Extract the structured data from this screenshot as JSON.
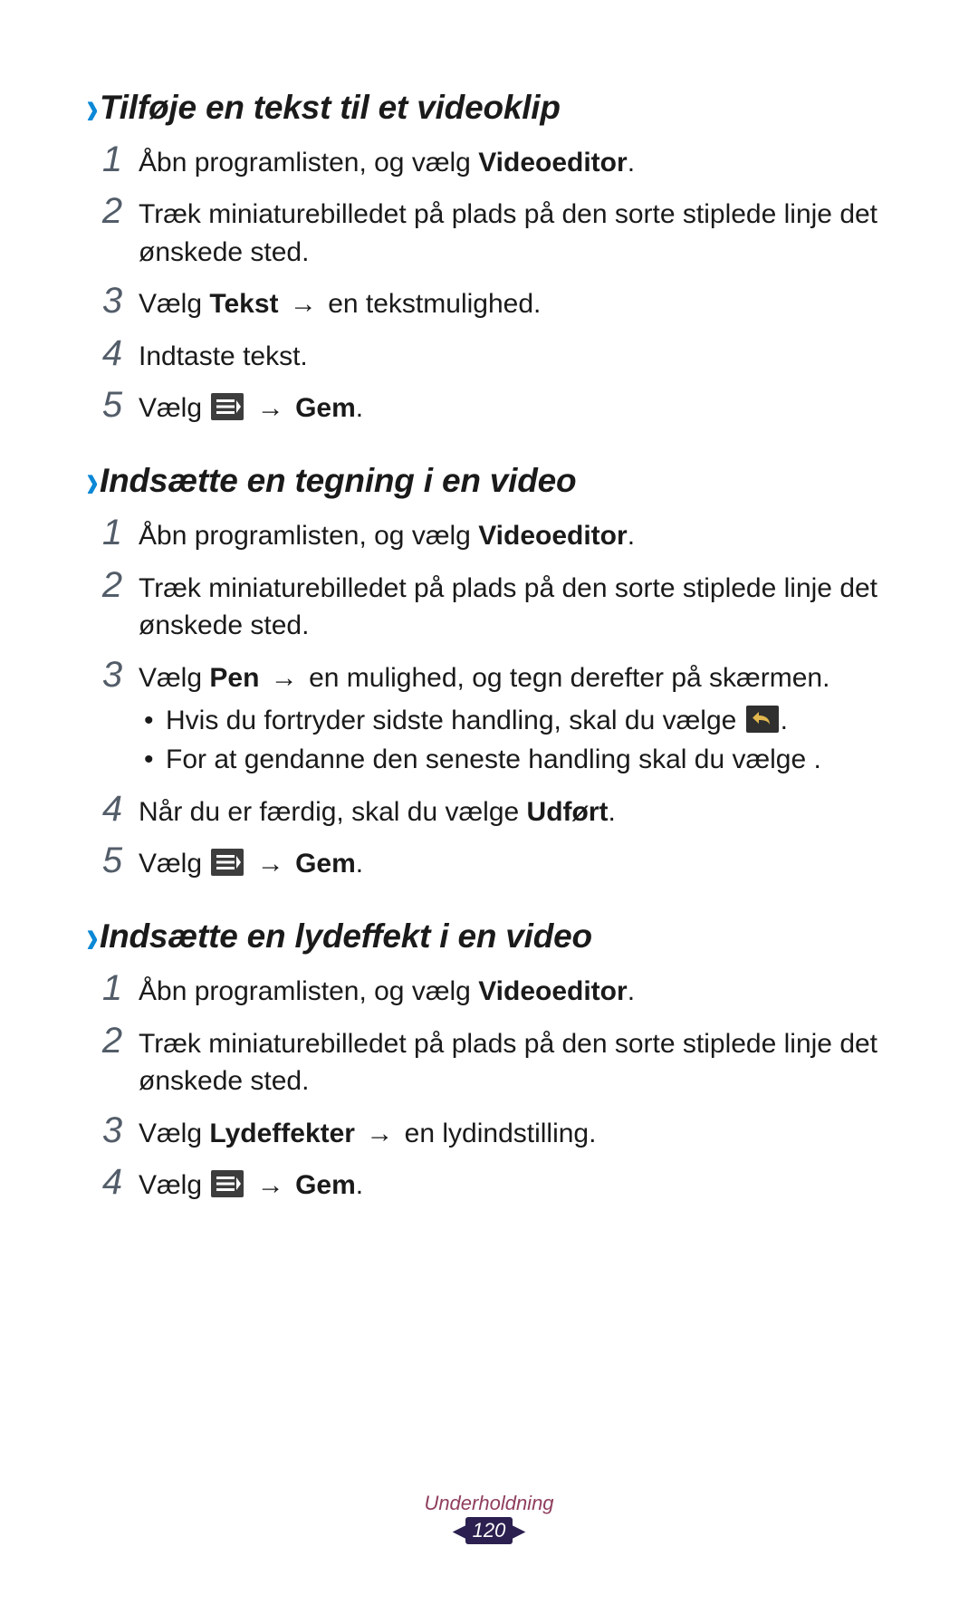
{
  "sections": [
    {
      "title": "Tilføje en tekst til et videoklip",
      "steps": [
        {
          "num": "1",
          "html": "Åbn programlisten, og vælg <span class='bold'>Videoeditor</span>."
        },
        {
          "num": "2",
          "html": "Træk miniaturebilledet på plads på den sorte stiplede linje det ønskede sted."
        },
        {
          "num": "3",
          "html": "Vælg <span class='bold'>Tekst</span> <span class='arrow'>→</span> en tekstmulighed."
        },
        {
          "num": "4",
          "html": "Indtaste tekst."
        },
        {
          "num": "5",
          "html": "Vælg {{menu-icon}} <span class='arrow'>→</span> <span class='bold'>Gem</span>."
        }
      ]
    },
    {
      "title": "Indsætte en tegning i en video",
      "steps": [
        {
          "num": "1",
          "html": "Åbn programlisten, og vælg <span class='bold'>Videoeditor</span>."
        },
        {
          "num": "2",
          "html": "Træk miniaturebilledet på plads på den sorte stiplede linje det ønskede sted."
        },
        {
          "num": "3",
          "html": "Vælg <span class='bold'>Pen</span> <span class='arrow'>→</span> en mulighed, og tegn derefter på skærmen.",
          "bullets": [
            "Hvis du fortryder sidste handling, skal du vælge {{undo-icon}}.",
            "For at gendanne den seneste handling skal du vælge       ."
          ]
        },
        {
          "num": "4",
          "html": "Når du er færdig, skal du vælge <span class='bold'>Udført</span>."
        },
        {
          "num": "5",
          "html": "Vælg {{menu-icon}} <span class='arrow'>→</span> <span class='bold'>Gem</span>."
        }
      ]
    },
    {
      "title": "Indsætte en lydeffekt i en video",
      "steps": [
        {
          "num": "1",
          "html": "Åbn programlisten, og vælg <span class='bold'>Videoeditor</span>."
        },
        {
          "num": "2",
          "html": "Træk miniaturebilledet på plads på den sorte stiplede linje det ønskede sted."
        },
        {
          "num": "3",
          "html": "Vælg <span class='bold'>Lydeffekter</span> <span class='arrow'>→</span> en lydindstilling."
        },
        {
          "num": "4",
          "html": "Vælg {{menu-icon}} <span class='arrow'>→</span> <span class='bold'>Gem</span>."
        }
      ]
    }
  ],
  "footer": {
    "label": "Underholdning",
    "page": "120"
  },
  "icons": {
    "menu": "<svg viewBox='0 0 36 30'><rect x='0' y='0' width='36' height='30' rx='2' fill='#3d3d3d'/><rect x='6' y='7' width='20' height='3' fill='#fff'/><rect x='6' y='13.5' width='20' height='3' fill='#fff'/><rect x='6' y='20' width='20' height='3' fill='#fff'/><path d='M28 8 L33 15 L28 22 Z' fill='#fff'/></svg>",
    "undo": "<svg viewBox='0 0 36 30'><rect x='0' y='0' width='36' height='30' rx='2' fill='#2f2f2f'/><path d='M 14 7 L 14 11 C 22 11 26 15 26 21 C 24 17 20 16 14 16 L 14 20 L 7 13.5 Z' fill='#e2b84e'/></svg>"
  }
}
